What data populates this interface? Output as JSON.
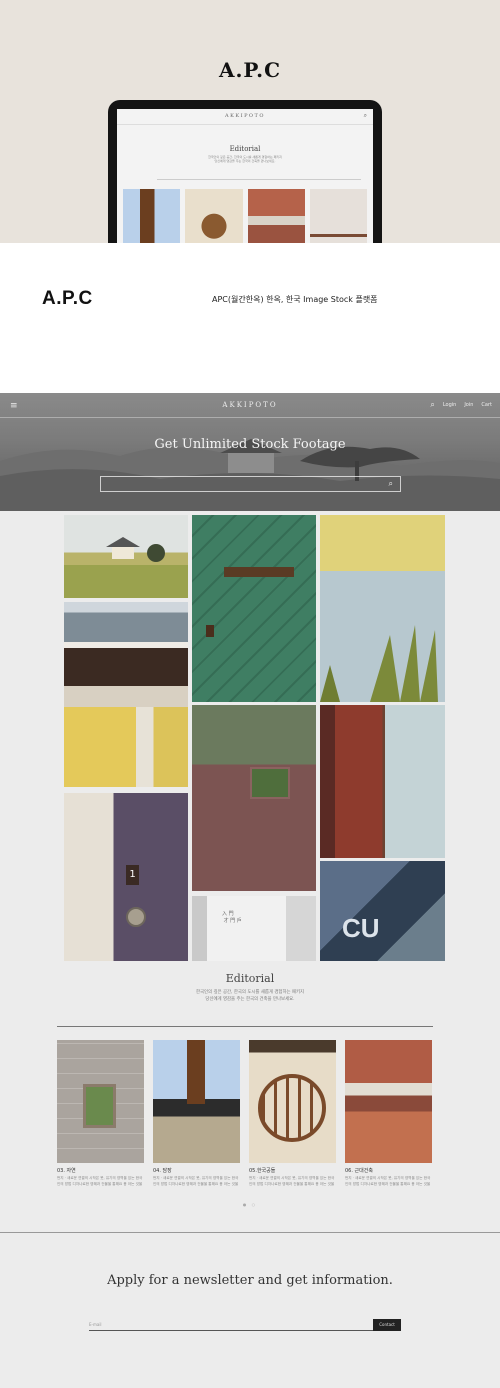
{
  "hero": {
    "title": "A.P.C",
    "tablet": {
      "logo": "AKKIPOTO",
      "heading": "Editorial",
      "desc_lines": [
        "한국인의 깊은 공간, 한국의 도시를 새롭게 경험하는 패키지",
        "당신에게 영감을 주는 한국의 건축을 만나보세요."
      ]
    }
  },
  "intro": {
    "logo": "A.P.C",
    "description": "APC(월간한옥) 한옥, 한국 Image Stock 플랫폼"
  },
  "site": {
    "logo": "AKKIPOTO",
    "nav": {
      "login": "Login",
      "join": "Join",
      "cart": "Cart"
    },
    "heading": "Get Unlimited Stock Footage",
    "search_placeholder": ""
  },
  "editorial": {
    "title": "Editorial",
    "desc_lines": [
      "한국인의 깊은 공간, 한국의 도시를 새롭게 경험하는 패키지",
      "당신에게 영감을 주는 한국의 건축을 만나보세요."
    ],
    "cards": [
      {
        "name": "03. 자연",
        "text": "먼지 · 새로운 연결의 시작은 못, 유기의 영역을 있는 한국인의 방법 디자나로한 영혜과 건물을 통해요 용 아는 것을"
      },
      {
        "name": "04. 담장",
        "text": "먼지 · 새로운 연결의 시작은 못, 유기의 영역을 있는 한국인의 방법 디자나로한 영혜과 건물을 통해요 용 아는 것을"
      },
      {
        "name": "05.한국공들",
        "text": "먼지 · 새로운 연결의 시작은 못, 유기의 영역을 있는 한국인의 방법 디자나로한 영혜과 건물을 통해요 용 아는 것을"
      },
      {
        "name": "06. 근대건축",
        "text": "먼지 · 새로운 연결의 시작은 못, 유기의 영역을 있는 한국인의 방법 디자나로한 영혜과 건물을 통해요 용 아는 것을"
      }
    ],
    "pagination": "● ○"
  },
  "newsletter": {
    "title": "Apply for a newsletter and get information.",
    "email_placeholder": "E-mail",
    "button": "Contact"
  },
  "gallery": {
    "door_number": "1",
    "sign_text": "入 門 \n 才 門 戶"
  },
  "icons": {
    "menu": "menu-icon",
    "search": "search-icon"
  }
}
